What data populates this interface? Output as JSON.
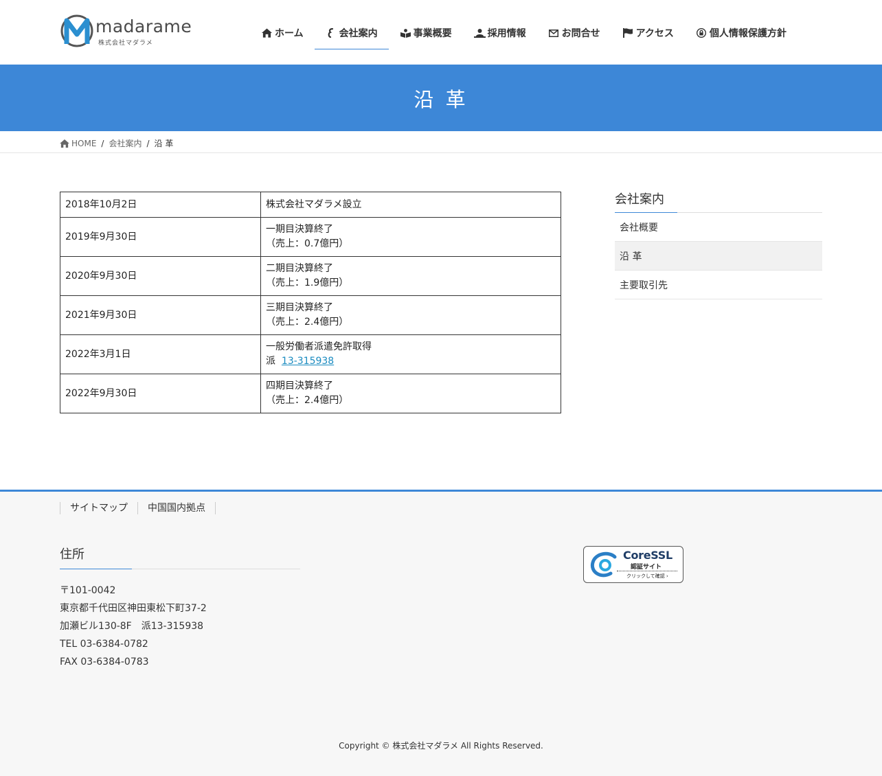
{
  "header": {
    "logo_word": "madarame",
    "logo_sub": "株式会社マダラメ",
    "nav": [
      {
        "label": "ホーム",
        "icon": "home-icon"
      },
      {
        "label": "会社案内",
        "icon": "company-icon"
      },
      {
        "label": "事業概要",
        "icon": "book-icon"
      },
      {
        "label": "採用情報",
        "icon": "recruit-icon"
      },
      {
        "label": "お問合せ",
        "icon": "envelope-icon"
      },
      {
        "label": "アクセス",
        "icon": "flag-icon"
      },
      {
        "label": "個人情報保護方針",
        "icon": "lock-icon"
      }
    ],
    "active_index": 1,
    "accent": "#3d87d7"
  },
  "page": {
    "title": "沿 革"
  },
  "breadcrumb": {
    "home": "HOME",
    "parent": "会社案内",
    "current": "沿 革"
  },
  "history": [
    {
      "date": "2018年10月2日",
      "line1": "株式会社マダラメ設立",
      "line2": ""
    },
    {
      "date": "2019年9月30日",
      "line1": "一期目決算終了",
      "line2": "（売上：0.7億円）"
    },
    {
      "date": "2020年9月30日",
      "line1": "二期目決算終了",
      "line2": "（売上：1.9億円）"
    },
    {
      "date": "2021年9月30日",
      "line1": "三期目決算終了",
      "line2": "（売上：2.4億円）"
    },
    {
      "date": "2022年3月1日",
      "line1": "一般労働者派遣免許取得",
      "line2_prefix": "派",
      "line2_link": "13-315938"
    },
    {
      "date": "2022年9月30日",
      "line1": "四期目決算終了",
      "line2": "（売上：2.4億円）"
    }
  ],
  "sidebar": {
    "title": "会社案内",
    "items": [
      "会社概要",
      "沿 革",
      "主要取引先"
    ],
    "current_index": 1
  },
  "footer": {
    "nav": [
      "サイトマップ",
      "中国国内拠点"
    ],
    "address": {
      "title": "住所",
      "lines": [
        "〒101-0042",
        "東京都千代田区神田東松下町37-2",
        "加瀬ビル130-8F　派13-315938",
        "TEL 03-6384-0782",
        "FAX 03-6384-0783"
      ]
    },
    "ssl": {
      "logo": "CoreSSL",
      "sub": "認証サイト",
      "check": "クリックして確認 ›"
    },
    "copyright": "Copyright © 株式会社マダラメ All Rights Reserved."
  }
}
